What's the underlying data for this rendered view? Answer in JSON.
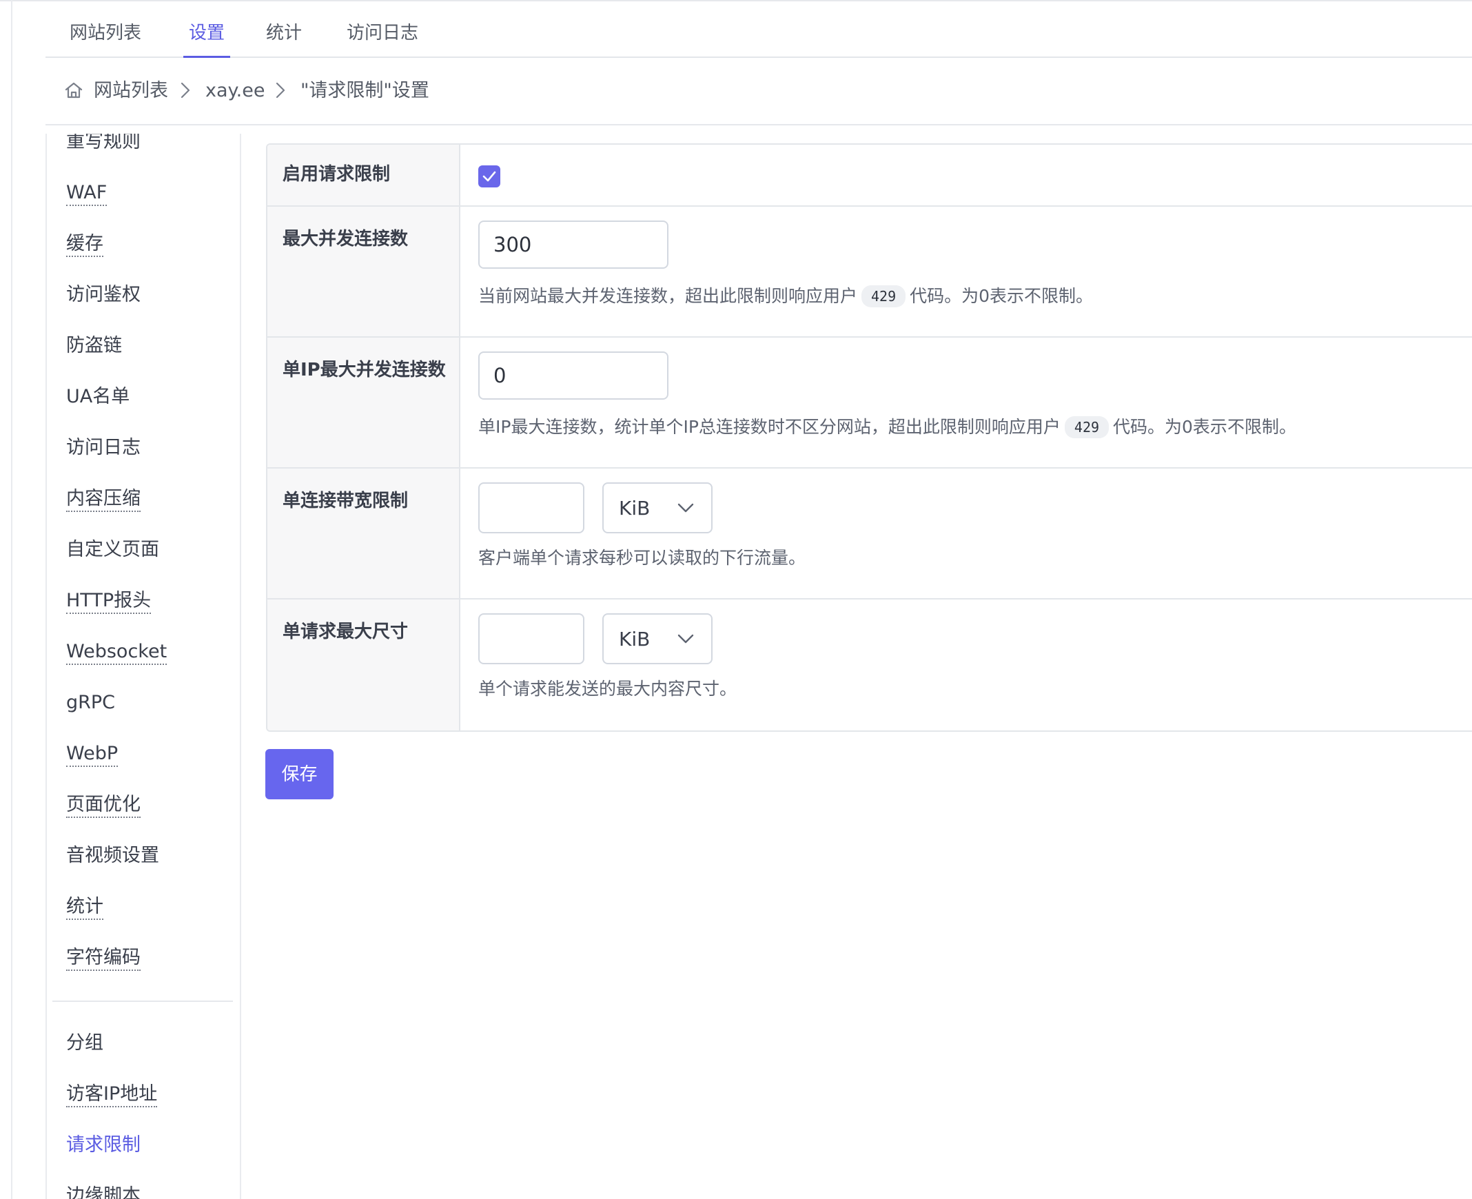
{
  "tabs": [
    {
      "label": "网站列表",
      "active": false
    },
    {
      "label": "设置",
      "active": true
    },
    {
      "label": "统计",
      "active": false
    },
    {
      "label": "访问日志",
      "active": false
    }
  ],
  "breadcrumb": {
    "home_icon": "home-icon",
    "items": [
      "网站列表",
      "xay.ee",
      "\"请求限制\"设置"
    ]
  },
  "sidebar": {
    "items": [
      {
        "label": "重写规则",
        "dotted": false,
        "active": false
      },
      {
        "label": "WAF",
        "dotted": true,
        "active": false
      },
      {
        "label": "缓存",
        "dotted": true,
        "active": false
      },
      {
        "label": "访问鉴权",
        "dotted": false,
        "active": false
      },
      {
        "label": "防盗链",
        "dotted": false,
        "active": false
      },
      {
        "label": "UA名单",
        "dotted": false,
        "active": false
      },
      {
        "label": "访问日志",
        "dotted": false,
        "active": false
      },
      {
        "label": "内容压缩",
        "dotted": true,
        "active": false
      },
      {
        "label": "自定义页面",
        "dotted": false,
        "active": false
      },
      {
        "label": "HTTP报头",
        "dotted": true,
        "active": false
      },
      {
        "label": "Websocket",
        "dotted": true,
        "active": false
      },
      {
        "label": "gRPC",
        "dotted": false,
        "active": false
      },
      {
        "label": "WebP",
        "dotted": true,
        "active": false
      },
      {
        "label": "页面优化",
        "dotted": true,
        "active": false
      },
      {
        "label": "音视频设置",
        "dotted": false,
        "active": false
      },
      {
        "label": "统计",
        "dotted": true,
        "active": false
      },
      {
        "label": "字符编码",
        "dotted": true,
        "active": false
      }
    ],
    "group_items": [
      {
        "label": "分组",
        "dotted": false,
        "active": false
      },
      {
        "label": "访客IP地址",
        "dotted": true,
        "active": false
      },
      {
        "label": "请求限制",
        "dotted": false,
        "active": true
      },
      {
        "label": "边缘脚本",
        "dotted": false,
        "active": false
      }
    ]
  },
  "form": {
    "enable": {
      "label": "启用请求限制",
      "checked": true
    },
    "max_conns": {
      "label": "最大并发连接数",
      "value": "300",
      "help_before": "当前网站最大并发连接数，超出此限制则响应用户",
      "code": "429",
      "help_after": "代码。为0表示不限制。"
    },
    "max_ip_conns": {
      "label": "单IP最大并发连接数",
      "value": "0",
      "help_before": "单IP最大连接数，统计单个IP总连接数时不区分网站，超出此限制则响应用户",
      "code": "429",
      "help_after": "代码。为0表示不限制。"
    },
    "bandwidth": {
      "label": "单连接带宽限制",
      "value": "",
      "unit": "KiB",
      "help": "客户端单个请求每秒可以读取的下行流量。"
    },
    "max_body": {
      "label": "单请求最大尺寸",
      "value": "",
      "unit": "KiB",
      "help": "单个请求能发送的最大内容尺寸。"
    }
  },
  "save_label": "保存",
  "colors": {
    "accent": "#6766ee",
    "border": "#e3e6ea",
    "label_bg": "#f7f7f8"
  }
}
